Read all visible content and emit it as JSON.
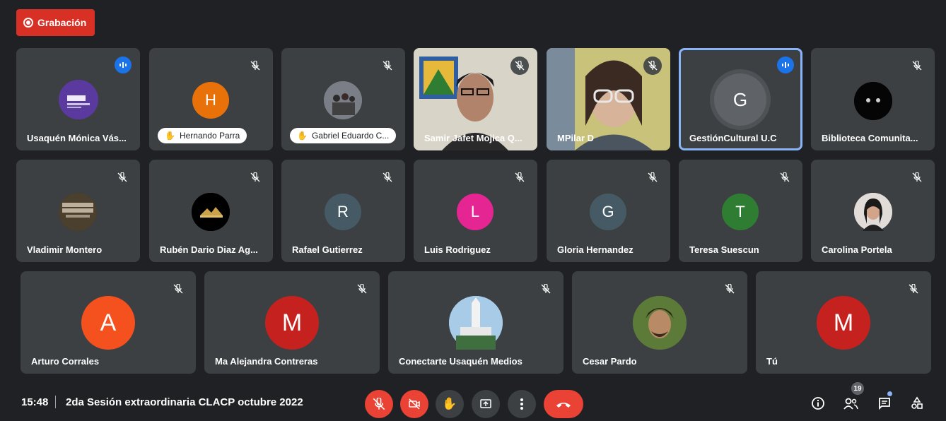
{
  "recording": {
    "label": "Grabación"
  },
  "participants": [
    {
      "name": "Usaquén Mónica Vás...",
      "status": "speaking"
    },
    {
      "name": "Hernando Parra",
      "initial": "H",
      "color": "#e8710a",
      "status": "muted",
      "hand_raised": true
    },
    {
      "name": "Gabriel Eduardo C...",
      "status": "muted",
      "hand_raised": true
    },
    {
      "name": "Samir Jafet Mojica Q...",
      "status": "muted"
    },
    {
      "name": "MPilar D",
      "status": "muted"
    },
    {
      "name": "GestiónCultural U.C",
      "initial": "G",
      "color": "#5f6368",
      "status": "speaking"
    },
    {
      "name": "Biblioteca Comunita...",
      "status": "muted"
    },
    {
      "name": "Vladimir Montero",
      "status": "muted"
    },
    {
      "name": "Rubén Dario Diaz Ag...",
      "status": "muted"
    },
    {
      "name": "Rafael Gutierrez",
      "initial": "R",
      "color": "#455a64",
      "status": "muted"
    },
    {
      "name": "Luis Rodriguez",
      "initial": "L",
      "color": "#e52592",
      "status": "muted"
    },
    {
      "name": "Gloria Hernandez",
      "initial": "G",
      "color": "#455a64",
      "status": "muted"
    },
    {
      "name": "Teresa Suescun",
      "initial": "T",
      "color": "#2e7d32",
      "status": "muted"
    },
    {
      "name": "Carolina Portela",
      "status": "muted"
    },
    {
      "name": "Arturo Corrales",
      "initial": "A",
      "color": "#f4511e",
      "status": "muted"
    },
    {
      "name": "Ma Alejandra Contreras",
      "initial": "M",
      "color": "#c5221f",
      "status": "muted"
    },
    {
      "name": "Conectarte Usaquén Medios",
      "status": "muted"
    },
    {
      "name": "Cesar Pardo",
      "status": "muted"
    },
    {
      "name": "Tú",
      "initial": "M",
      "color": "#c5221f",
      "status": "muted"
    }
  ],
  "bottom_bar": {
    "time": "15:48",
    "meeting_title": "2da Sesión extraordinaria CLACP octubre 2022",
    "people_count": "19"
  },
  "icons": {
    "mic_off": "mic-off-icon",
    "camera_off": "camera-off-icon",
    "raise_hand": "raise-hand-icon",
    "present": "present-screen-icon",
    "more": "more-options-icon",
    "leave": "leave-call-icon",
    "info": "info-icon",
    "people": "people-icon",
    "chat": "chat-icon",
    "activities": "activities-icon"
  },
  "colors": {
    "background": "#202124",
    "tile": "#3c4043",
    "danger": "#ea4335",
    "accent": "#1a73e8"
  }
}
